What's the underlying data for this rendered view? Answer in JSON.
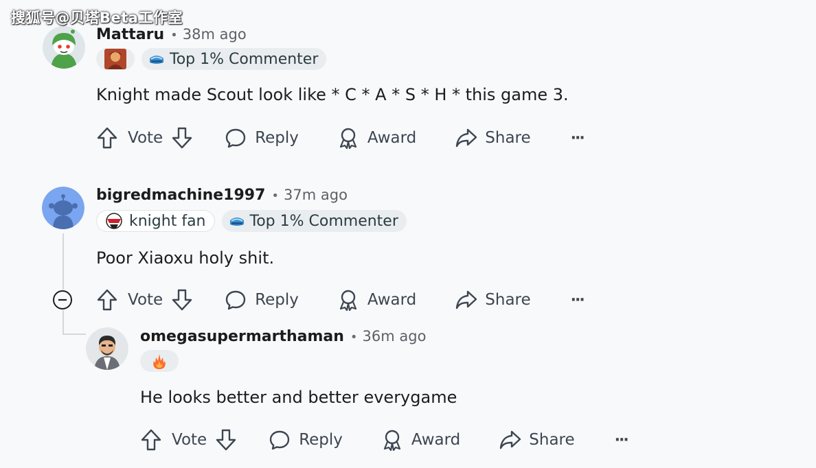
{
  "watermark": "搜狐号@贝塔Beta工作室",
  "comments": [
    {
      "username": "Mattaru",
      "time": "38m ago",
      "flairs": [
        "Top 1% Commenter"
      ],
      "body": "Knight made Scout look like * C * A * S * H * this game 3.",
      "actions": {
        "vote": "Vote",
        "reply": "Reply",
        "award": "Award",
        "share": "Share",
        "more": "···"
      }
    },
    {
      "username": "bigredmachine1997",
      "time": "37m ago",
      "flairs": [
        "knight fan",
        "Top 1% Commenter"
      ],
      "body": "Poor Xiaoxu holy shit.",
      "actions": {
        "vote": "Vote",
        "reply": "Reply",
        "award": "Award",
        "share": "Share",
        "more": "···"
      }
    },
    {
      "username": "omegasupermarthaman",
      "time": "36m ago",
      "flairs": [],
      "body": "He looks better and better everygame",
      "actions": {
        "vote": "Vote",
        "reply": "Reply",
        "award": "Award",
        "share": "Share",
        "more": "···"
      }
    }
  ],
  "colors": {
    "avatar_blue": "#7aa5f0",
    "avatar_green": "#4ea24a",
    "text": "#1c1c1c",
    "muted": "#5c6166"
  },
  "icons": [
    "upvote-icon",
    "downvote-icon",
    "comment-icon",
    "award-icon",
    "share-icon",
    "more-icon",
    "collapse-icon"
  ]
}
